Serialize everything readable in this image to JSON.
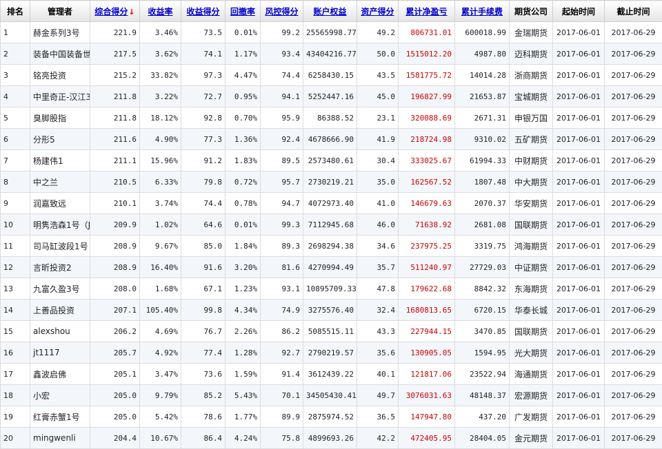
{
  "headers": [
    {
      "label": "排名",
      "link": false
    },
    {
      "label": "管理者",
      "link": false
    },
    {
      "label": "综合得分",
      "link": true,
      "sorted": true
    },
    {
      "label": "收益率",
      "link": true
    },
    {
      "label": "收益得分",
      "link": true
    },
    {
      "label": "回撤率",
      "link": true
    },
    {
      "label": "风控得分",
      "link": true
    },
    {
      "label": "账户权益",
      "link": true
    },
    {
      "label": "资产得分",
      "link": true
    },
    {
      "label": "累计净盈亏",
      "link": true
    },
    {
      "label": "累计手续费",
      "link": true
    },
    {
      "label": "期货公司",
      "link": false
    },
    {
      "label": "起始时间",
      "link": false
    },
    {
      "label": "截止时间",
      "link": false
    }
  ],
  "sort_arrow": "↓",
  "rows": [
    [
      "1",
      "赫金系列3号",
      "221.9",
      "3.46%",
      "73.5",
      "0.01%",
      "99.2",
      "25565998.77",
      "49.2",
      "806731.01",
      "600018.99",
      "金瑞期货",
      "2017-06-01",
      "2017-06-29"
    ],
    [
      "2",
      "装备中国装备世",
      "217.5",
      "3.62%",
      "74.1",
      "1.17%",
      "93.4",
      "43404216.77",
      "50.0",
      "1515012.20",
      "4987.80",
      "迈科期货",
      "2017-06-01",
      "2017-06-29"
    ],
    [
      "3",
      "铭亮投资",
      "215.2",
      "33.82%",
      "97.3",
      "4.47%",
      "74.4",
      "6258430.15",
      "43.5",
      "1581775.72",
      "14014.28",
      "浙商期货",
      "2017-06-01",
      "2017-06-29"
    ],
    [
      "4",
      "中里奇正-汉江3",
      "211.8",
      "3.22%",
      "72.7",
      "0.95%",
      "94.1",
      "5252447.16",
      "45.0",
      "196827.99",
      "21653.87",
      "宝城期货",
      "2017-06-01",
      "2017-06-29"
    ],
    [
      "5",
      "臭脚股指",
      "211.8",
      "18.12%",
      "92.8",
      "0.70%",
      "95.9",
      "86388.52",
      "23.1",
      "320088.69",
      "2671.31",
      "申银万国",
      "2017-06-01",
      "2017-06-29"
    ],
    [
      "6",
      "分形5",
      "211.6",
      "4.90%",
      "77.3",
      "1.36%",
      "92.4",
      "4678666.90",
      "41.9",
      "218724.98",
      "9310.02",
      "五矿期货",
      "2017-06-01",
      "2017-06-29"
    ],
    [
      "7",
      "杨建伟1",
      "211.1",
      "15.96%",
      "91.2",
      "1.83%",
      "89.5",
      "2573480.61",
      "30.4",
      "333025.67",
      "61994.33",
      "中财期货",
      "2017-06-01",
      "2017-06-29"
    ],
    [
      "8",
      "中之兰",
      "210.5",
      "6.33%",
      "79.8",
      "0.72%",
      "95.7",
      "2730219.21",
      "35.0",
      "162567.52",
      "1807.48",
      "中大期货",
      "2017-06-01",
      "2017-06-29"
    ],
    [
      "9",
      "润嘉致远",
      "210.1",
      "3.74%",
      "74.4",
      "0.78%",
      "94.7",
      "4072973.40",
      "41.0",
      "146679.63",
      "2070.37",
      "华安期货",
      "2017-06-01",
      "2017-06-29"
    ],
    [
      "10",
      "明隽浩森1号（J",
      "209.9",
      "1.02%",
      "64.6",
      "0.01%",
      "99.3",
      "7112945.68",
      "46.0",
      "71638.92",
      "2681.08",
      "国联期货",
      "2017-06-01",
      "2017-06-29"
    ],
    [
      "11",
      "司马缸波段1号",
      "208.9",
      "9.67%",
      "85.0",
      "1.84%",
      "89.3",
      "2698294.38",
      "34.6",
      "237975.25",
      "3319.75",
      "鸿海期货",
      "2017-06-01",
      "2017-06-29"
    ],
    [
      "12",
      "言昕投资2",
      "208.9",
      "16.40%",
      "91.6",
      "3.20%",
      "81.6",
      "4270994.49",
      "35.7",
      "511240.97",
      "27729.03",
      "中证期货",
      "2017-06-01",
      "2017-06-29"
    ],
    [
      "13",
      "九富久盈3号",
      "208.0",
      "1.68%",
      "67.1",
      "1.23%",
      "93.1",
      "10895709.33",
      "47.8",
      "179622.68",
      "8842.32",
      "东海期货",
      "2017-06-01",
      "2017-06-29"
    ],
    [
      "14",
      "上善品投资",
      "207.1",
      "105.40%",
      "99.8",
      "4.34%",
      "74.9",
      "3275576.40",
      "32.4",
      "1680813.65",
      "6720.15",
      "华泰长城",
      "2017-06-01",
      "2017-06-29"
    ],
    [
      "15",
      "alexshou",
      "206.2",
      "4.69%",
      "76.7",
      "2.26%",
      "86.2",
      "5085515.11",
      "43.3",
      "227944.15",
      "3470.85",
      "国联期货",
      "2017-06-01",
      "2017-06-29"
    ],
    [
      "16",
      "jt1117",
      "205.7",
      "4.92%",
      "77.4",
      "1.28%",
      "92.7",
      "2790219.57",
      "35.6",
      "130905.05",
      "1594.95",
      "光大期货",
      "2017-06-01",
      "2017-06-29"
    ],
    [
      "17",
      "鑫波启佛",
      "205.1",
      "3.47%",
      "73.6",
      "1.59%",
      "91.4",
      "3612439.22",
      "40.1",
      "121817.06",
      "23522.94",
      "海通期货",
      "2017-06-01",
      "2017-06-29"
    ],
    [
      "18",
      "小宏",
      "205.0",
      "9.79%",
      "85.2",
      "5.43%",
      "70.1",
      "34505430.41",
      "49.7",
      "3076031.63",
      "48148.37",
      "宏源期货",
      "2017-06-01",
      "2017-06-29"
    ],
    [
      "19",
      "红膏赤蟹1号",
      "205.0",
      "5.42%",
      "78.6",
      "1.77%",
      "89.9",
      "2875974.52",
      "36.5",
      "147947.80",
      "437.20",
      "广发期货",
      "2017-06-01",
      "2017-06-29"
    ],
    [
      "20",
      "mingwenli",
      "204.4",
      "10.67%",
      "86.4",
      "4.24%",
      "75.8",
      "4899693.26",
      "42.2",
      "472405.95",
      "28404.05",
      "金元期货",
      "2017-06-01",
      "2017-06-29"
    ]
  ]
}
